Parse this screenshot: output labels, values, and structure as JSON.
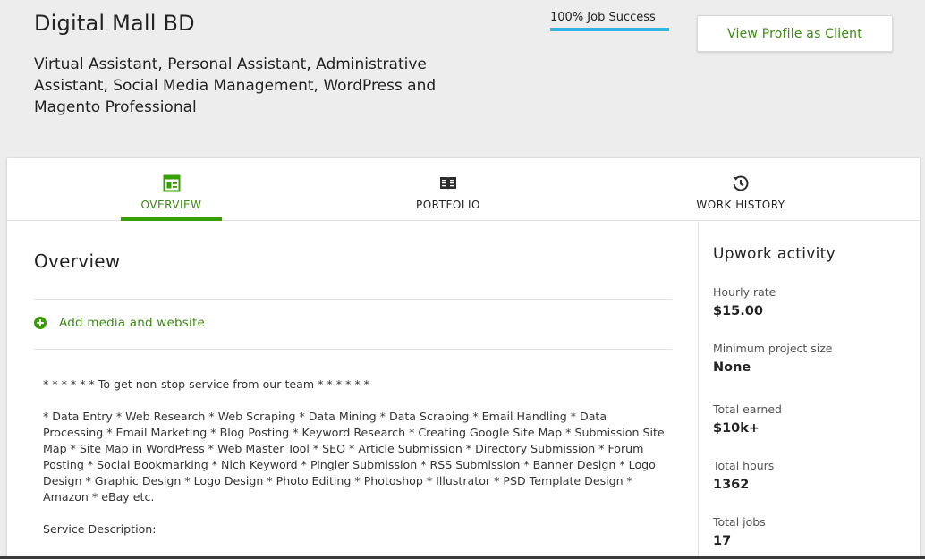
{
  "profile": {
    "name": "Digital Mall BD",
    "headline": "Virtual Assistant, Personal Assistant, Administrative Assistant, Social Media Management, WordPress and Magento Professional",
    "job_success_label": "100% Job Success",
    "job_success_percent": 100,
    "view_profile_label": "View Profile as Client"
  },
  "tabs": [
    {
      "label": "OVERVIEW",
      "icon": "overview-icon",
      "active": true
    },
    {
      "label": "PORTFOLIO",
      "icon": "portfolio-icon",
      "active": false
    },
    {
      "label": "WORK HISTORY",
      "icon": "history-icon",
      "active": false
    }
  ],
  "overview": {
    "title": "Overview",
    "add_media_label": "Add media and website",
    "description": [
      "* * * * * * To get non-stop service from our team * * * * * *",
      "* Data Entry * Web Research * Web Scraping * Data Mining * Data Scraping * Email Handling * Data Processing * Email Marketing * Blog Posting * Keyword Research * Creating Google Site Map * Submission Site Map * Site Map in WordPress * Web Master Tool * SEO * Article Submission * Directory Submission * Forum Posting * Social Bookmarking * Nich Keyword * Pingler Submission * RSS Submission * Banner Design * Logo Design * Graphic Design * Logo Design * Photo Editing * Photoshop * Illustrator * PSD Template Design * Amazon * eBay etc.",
      "Service Description:"
    ]
  },
  "activity": {
    "title": "Upwork activity",
    "stats": [
      {
        "label": "Hourly rate",
        "value": "$15.00"
      },
      {
        "label": "Minimum project size",
        "value": "None"
      },
      {
        "label": "Total earned",
        "value": "$10k+"
      },
      {
        "label": "Total hours",
        "value": "1362"
      },
      {
        "label": "Total jobs",
        "value": "17"
      }
    ]
  },
  "colors": {
    "accent_green": "#37a000",
    "link_green": "#3c8a12",
    "job_success_blue": "#37b3e0"
  }
}
